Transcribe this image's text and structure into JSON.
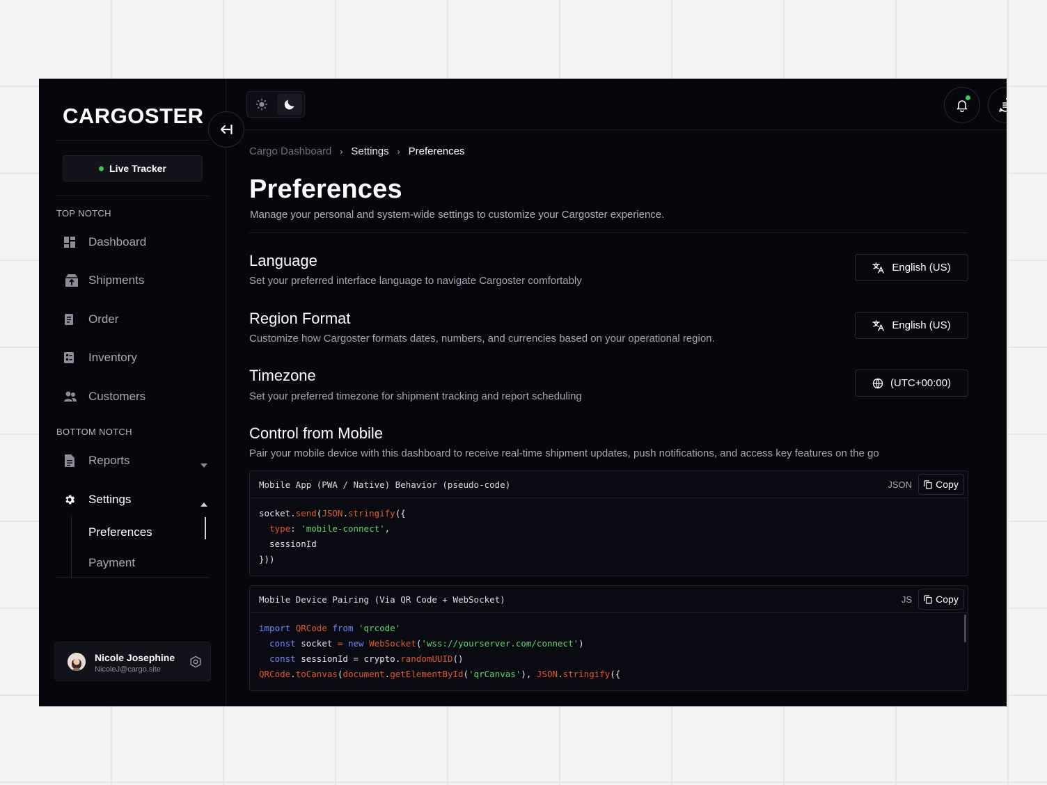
{
  "app": {
    "logo": "CARGOSTER"
  },
  "sidebar": {
    "live_tracker": "Live Tracker",
    "top_section": "TOP NOTCH",
    "bottom_section": "BOTTOM NOTCH",
    "items": [
      {
        "label": "Dashboard",
        "icon": "dashboard-icon"
      },
      {
        "label": "Shipments",
        "icon": "shipments-icon"
      },
      {
        "label": "Order",
        "icon": "order-icon"
      },
      {
        "label": "Inventory",
        "icon": "inventory-icon"
      },
      {
        "label": "Customers",
        "icon": "customers-icon"
      }
    ],
    "bottom_items": [
      {
        "label": "Reports",
        "icon": "reports-icon"
      },
      {
        "label": "Settings",
        "icon": "settings-icon"
      }
    ],
    "settings_sub": [
      "Preferences",
      "Payment"
    ],
    "user": {
      "name": "Nicole Josephine",
      "email": "NicoleJ@cargo.site"
    }
  },
  "breadcrumb": [
    "Cargo Dashboard",
    "Settings",
    "Preferences"
  ],
  "page": {
    "title": "Preferences",
    "description": "Manage your personal and system-wide settings to customize your Cargoster experience."
  },
  "settings": {
    "language": {
      "title": "Language",
      "desc": "Set your preferred interface language to navigate Cargoster comfortably",
      "value": "English (US)"
    },
    "region": {
      "title": "Region Format",
      "desc": "Customize how Cargoster formats dates, numbers, and currencies based on your operational region.",
      "value": "English (US)"
    },
    "timezone": {
      "title": "Timezone",
      "desc": "Set your preferred timezone for shipment tracking and report scheduling",
      "value": "(UTC+00:00)"
    },
    "mobile": {
      "title": "Control from Mobile",
      "desc": "Pair your mobile device with this dashboard to receive real-time shipment updates, push notifications, and access key features on the go"
    }
  },
  "code_blocks": [
    {
      "title": "Mobile App (PWA / Native) Behavior (pseudo-code)",
      "lang": "JSON",
      "copy": "Copy"
    },
    {
      "title": "Mobile Device Pairing (Via QR Code + WebSocket)",
      "lang": "JS",
      "copy": "Copy"
    }
  ],
  "code1": {
    "l1a": "socket",
    "l1b": ".",
    "l1c": "send",
    "l1d": "(",
    "l1e": "JSON",
    "l1f": ".",
    "l1g": "stringify",
    "l1h": "({",
    "l2a": "  ",
    "l2b": "type",
    "l2c": ": ",
    "l2d": "'mobile-connect'",
    "l2e": ",",
    "l3": "  sessionId",
    "l4": "}))"
  },
  "code2": {
    "l1a": "import",
    "l1b": " ",
    "l1c": "QRCode",
    "l1d": " ",
    "l1e": "from",
    "l1f": " ",
    "l1g": "'qrcode'",
    "l2a": "  ",
    "l2b": "const",
    "l2c": " socket ",
    "l2d": "=",
    "l2e": " ",
    "l2f": "new",
    "l2g": " ",
    "l2h": "WebSocket",
    "l2i": "(",
    "l2j": "'wss://yourserver.com/connect'",
    "l2k": ")",
    "l3a": "  ",
    "l3b": "const",
    "l3c": " sessionId = crypto.",
    "l3d": "randomUUID",
    "l3e": "()",
    "l4a": "QRCode",
    "l4b": ".",
    "l4c": "toCanvas",
    "l4d": "(",
    "l4e": "document",
    "l4f": ".",
    "l4g": "getElementById",
    "l4h": "(",
    "l4i": "'qrCanvas'",
    "l4j": "), ",
    "l4k": "JSON",
    "l4l": ".",
    "l4m": "stringify",
    "l4n": "({"
  },
  "colors": {
    "accent_green": "#2fd05a",
    "background": "#06060d",
    "code_orange": "#e4582e",
    "code_green": "#5cd86b",
    "code_blue": "#6f88ff"
  }
}
